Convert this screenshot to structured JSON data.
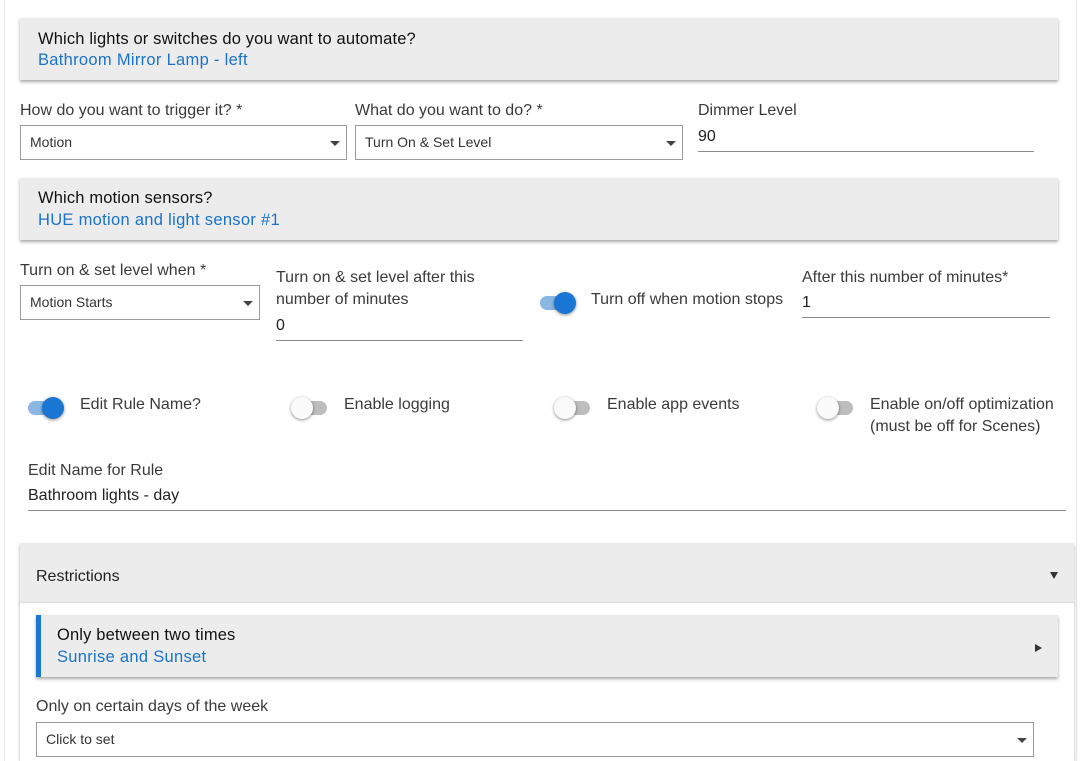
{
  "lights_panel": {
    "title": "Which lights or switches do you want to automate?",
    "value": "Bathroom Mirror Lamp - left"
  },
  "trigger": {
    "label": "How do you want to trigger it? *",
    "value": "Motion"
  },
  "action": {
    "label": "What do you want to do? *",
    "value": "Turn On & Set Level"
  },
  "dimmer": {
    "label": "Dimmer Level",
    "value": "90"
  },
  "motion_panel": {
    "title": "Which motion sensors?",
    "value": "HUE motion and light sensor #1"
  },
  "when": {
    "label": "Turn on & set level when *",
    "value": "Motion Starts"
  },
  "delay": {
    "label_line1": "Turn on & set level after this",
    "label_line2": "number of minutes",
    "value": "0"
  },
  "turn_off": {
    "label": "Turn off when motion stops",
    "on": true
  },
  "after_minutes": {
    "label": "After this number of minutes*",
    "value": "1"
  },
  "toggles": {
    "edit_rule_name": {
      "label": "Edit Rule Name?",
      "on": true
    },
    "enable_logging": {
      "label": "Enable logging",
      "on": false
    },
    "enable_app_events": {
      "label": "Enable app events",
      "on": false
    },
    "enable_optimization": {
      "label_line1": "Enable on/off optimization",
      "label_line2": "(must be off for Scenes)",
      "on": false
    }
  },
  "rule_name": {
    "label": "Edit Name for Rule",
    "value": "Bathroom lights - day"
  },
  "restrictions": {
    "title": "Restrictions",
    "times": {
      "title": "Only between two times",
      "value": "Sunrise and Sunset"
    },
    "days": {
      "label": "Only on certain days of the week",
      "placeholder": "Click to set"
    }
  },
  "colors": {
    "accent": "#1976d2",
    "link": "#1a73c8",
    "panel_bg": "#ececec"
  }
}
